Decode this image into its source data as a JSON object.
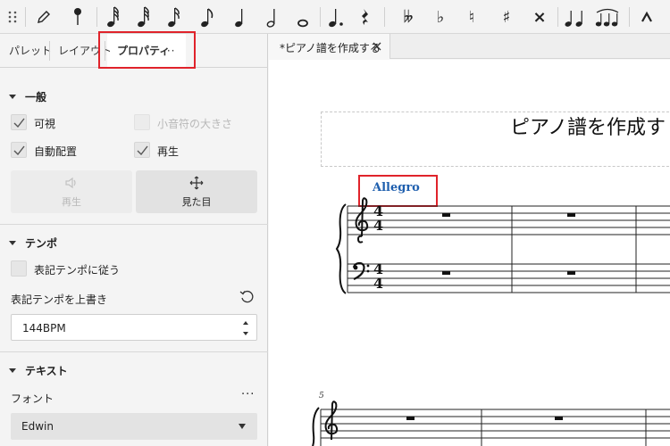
{
  "toolbar": {
    "items": [
      {
        "icon": "drag-handle-icon"
      },
      {
        "icon": "pencil-icon"
      },
      {
        "icon": "pin-icon"
      },
      {
        "icon": "64th-note-icon"
      },
      {
        "icon": "32nd-note-icon"
      },
      {
        "icon": "16th-note-icon"
      },
      {
        "icon": "eighth-note-icon"
      },
      {
        "icon": "quarter-note-icon"
      },
      {
        "icon": "half-note-icon"
      },
      {
        "icon": "whole-note-icon"
      },
      {
        "icon": "augmentation-dot-icon"
      },
      {
        "icon": "quarter-rest-icon"
      },
      {
        "icon": "double-flat-icon",
        "glyph": "𝄫"
      },
      {
        "icon": "flat-icon",
        "glyph": "♭"
      },
      {
        "icon": "natural-icon",
        "glyph": "♮"
      },
      {
        "icon": "sharp-icon",
        "glyph": "♯"
      },
      {
        "icon": "double-sharp-icon",
        "glyph": "×"
      },
      {
        "icon": "tie-icon"
      },
      {
        "icon": "slur-icon"
      },
      {
        "icon": "marcato-icon"
      }
    ]
  },
  "panel": {
    "tabs": [
      {
        "label": "パレット"
      },
      {
        "label": "レイアウト"
      },
      {
        "label": "プロパティ"
      }
    ],
    "tab_more": "···",
    "general": {
      "title": "一般",
      "visible": "可視",
      "small_note": "小音符の大きさ",
      "auto_place": "自動配置",
      "play": "再生",
      "btn_play": "再生",
      "btn_appearance": "見た目"
    },
    "tempo": {
      "title": "テンポ",
      "follow_written": "表記テンポに従う",
      "override_label": "表記テンポを上書き",
      "value": "144BPM"
    },
    "text": {
      "title": "テキスト",
      "font_label": "フォント",
      "font_more": "···",
      "font_value": "Edwin"
    }
  },
  "document": {
    "tab_title": "*ピアノ譜を作成する",
    "score_title": "ピアノ譜を作成す",
    "tempo_marking": "Allegro",
    "time_sig_top": "4",
    "time_sig_bottom": "4",
    "measure_number": "5"
  },
  "colors": {
    "highlight": "#e0232b",
    "tempo_text": "#1f5fae"
  }
}
